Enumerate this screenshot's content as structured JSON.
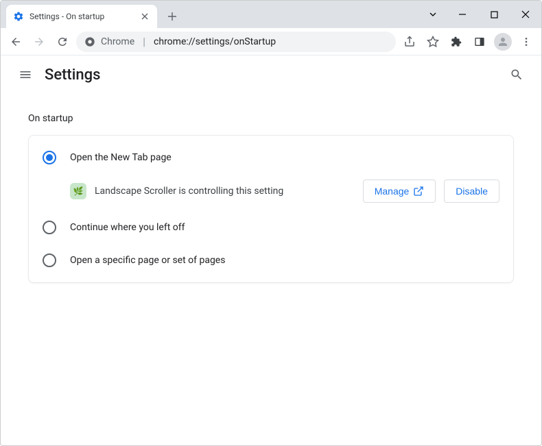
{
  "titlebar": {
    "tab_title": "Settings - On startup"
  },
  "addrbar": {
    "prefix": "Chrome",
    "url": "chrome://settings/onStartup"
  },
  "header": {
    "title": "Settings"
  },
  "section": {
    "title": "On startup"
  },
  "options": {
    "opt1": "Open the New Tab page",
    "opt2": "Continue where you left off",
    "opt3": "Open a specific page or set of pages"
  },
  "controlled": {
    "text": "Landscape Scroller is controlling this setting",
    "manage": "Manage",
    "disable": "Disable"
  }
}
